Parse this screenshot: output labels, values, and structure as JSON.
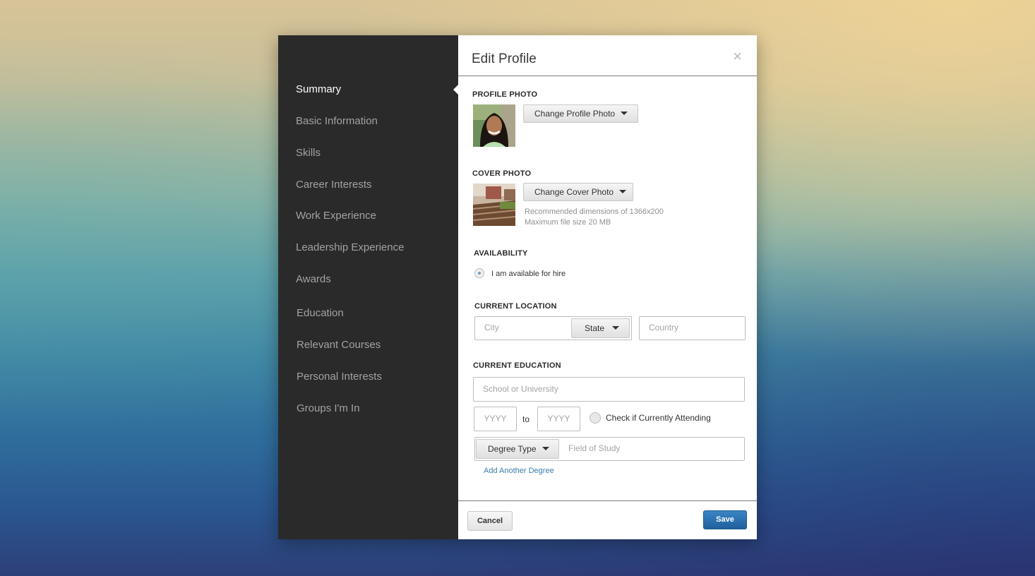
{
  "sidebar": {
    "items": [
      {
        "label": "Summary",
        "active": true
      },
      {
        "label": "Basic Information"
      },
      {
        "label": "Skills"
      },
      {
        "label": "Career Interests"
      },
      {
        "label": "Work Experience"
      },
      {
        "label": "Leadership Experience"
      },
      {
        "label": "Awards"
      },
      {
        "label": "Education"
      },
      {
        "label": "Relevant Courses"
      },
      {
        "label": "Personal Interests"
      },
      {
        "label": "Groups I'm In"
      }
    ]
  },
  "dialog": {
    "title": "Edit Profile",
    "close_icon": "×"
  },
  "profile_photo": {
    "label": "PROFILE PHOTO",
    "button": "Change Profile Photo"
  },
  "cover_photo": {
    "label": "COVER PHOTO",
    "button": "Change Cover Photo",
    "hint_dimensions": "Recommended dimensions of 1366x200",
    "hint_size": "Maximum file size 20 MB"
  },
  "availability": {
    "label": "AVAILABILITY",
    "option": "I am available for hire",
    "checked": true
  },
  "location": {
    "label": "CURRENT LOCATION",
    "city_placeholder": "City",
    "state_button": "State",
    "country_placeholder": "Country"
  },
  "education": {
    "label": "CURRENT EDUCATION",
    "school_placeholder": "School or University",
    "year_start_placeholder": "YYYY",
    "to_label": "to",
    "year_end_placeholder": "YYYY",
    "attending_label": "Check if Currently Attending",
    "degree_button": "Degree Type",
    "field_placeholder": "Field of Study",
    "add_link": "Add Another Degree"
  },
  "footer": {
    "cancel": "Cancel",
    "save": "Save"
  },
  "colors": {
    "sidebar_bg": "#2a2a2a",
    "save_blue": "#2a6faf",
    "link_blue": "#3b7dab"
  }
}
